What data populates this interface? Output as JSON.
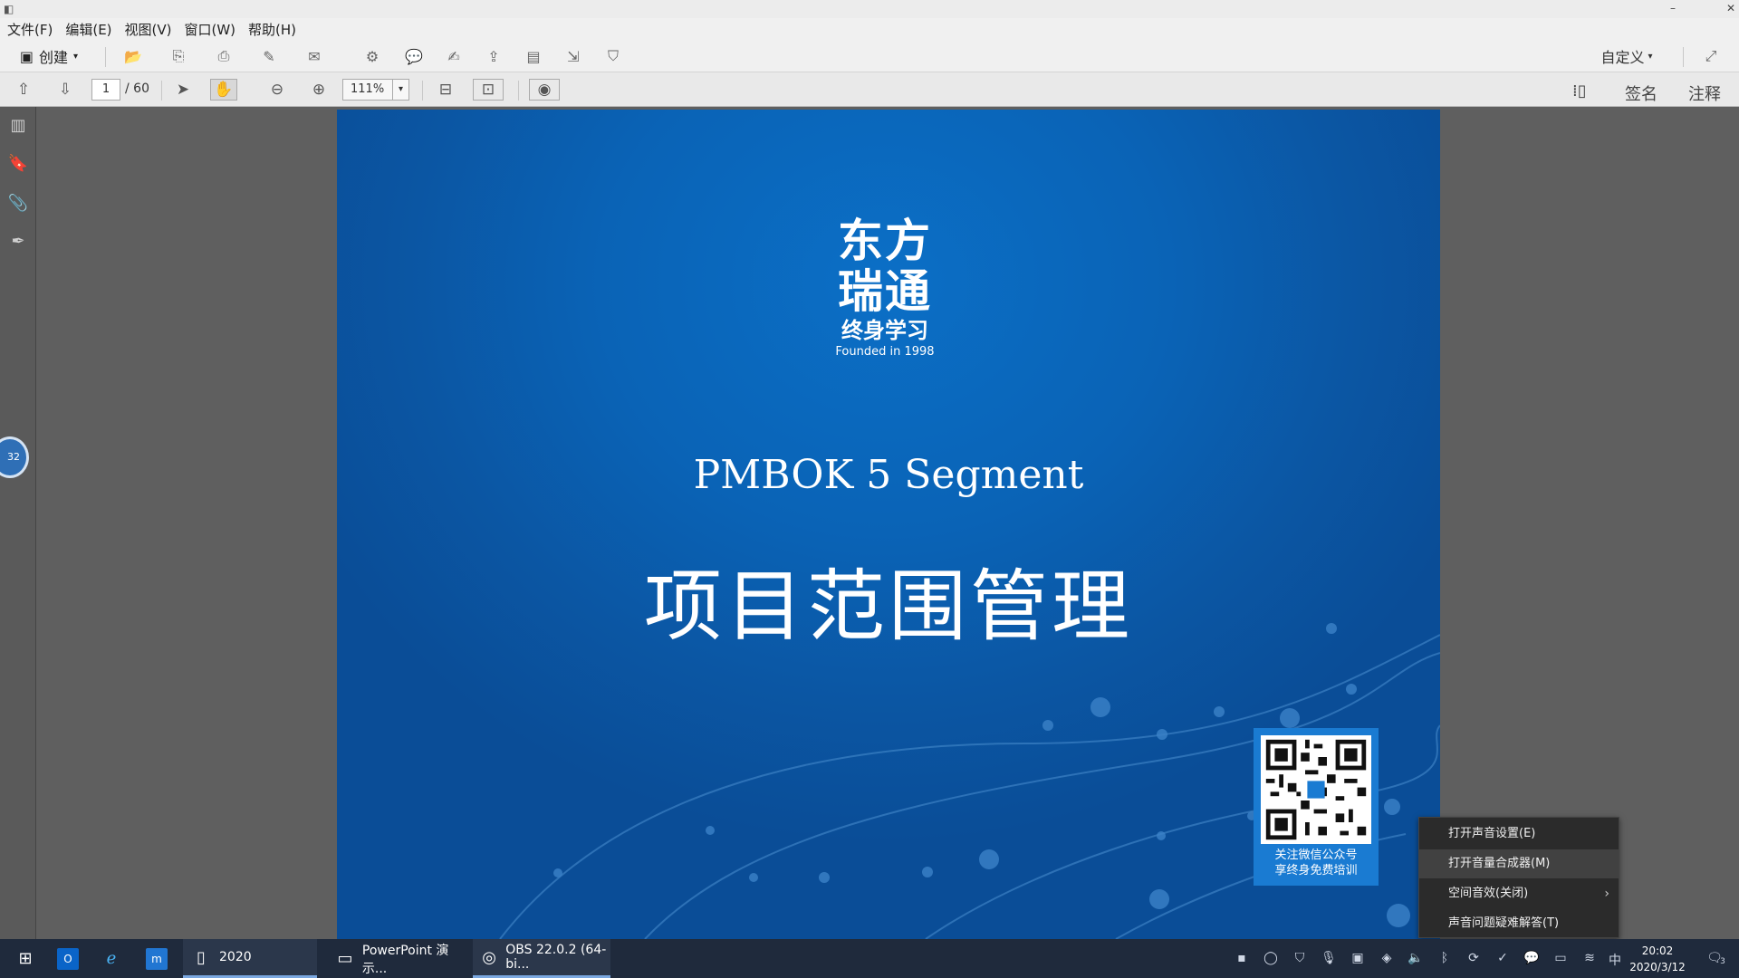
{
  "menubar": {
    "items": [
      "文件(F)",
      "编辑(E)",
      "视图(V)",
      "窗口(W)",
      "帮助(H)"
    ]
  },
  "toolbar": {
    "create_label": "创建",
    "custom_label": "自定义"
  },
  "navbar": {
    "current_page": "1",
    "total_pages": "/ 60",
    "zoom": "111%",
    "sign_label": "签名",
    "comment_label": "注释"
  },
  "obs_bubble": "32",
  "slide": {
    "logo_line1": "东方",
    "logo_line2": "瑞通",
    "logo_line3": "终身学习",
    "logo_line4": "Founded in 1998",
    "subtitle": "PMBOK 5 Segment",
    "title": "项目范围管理",
    "qr_text_line1": "关注微信公众号",
    "qr_text_line2": "享终身免费培训"
  },
  "context_menu": {
    "items": [
      "打开声音设置(E)",
      "打开音量合成器(M)",
      "空间音效(关闭)",
      "声音问题疑难解答(T)"
    ]
  },
  "taskbar": {
    "items": [
      "2020",
      "PowerPoint 演示...",
      "OBS 22.0.2 (64-bi..."
    ],
    "clock_time": "20:02",
    "clock_date": "2020/3/12",
    "notification_count": "3",
    "ime_label": "中"
  },
  "colors": {
    "slide_blue": "#0a63b6",
    "taskbar": "#1f2a3c",
    "context_menu": "#2b2b2b"
  }
}
